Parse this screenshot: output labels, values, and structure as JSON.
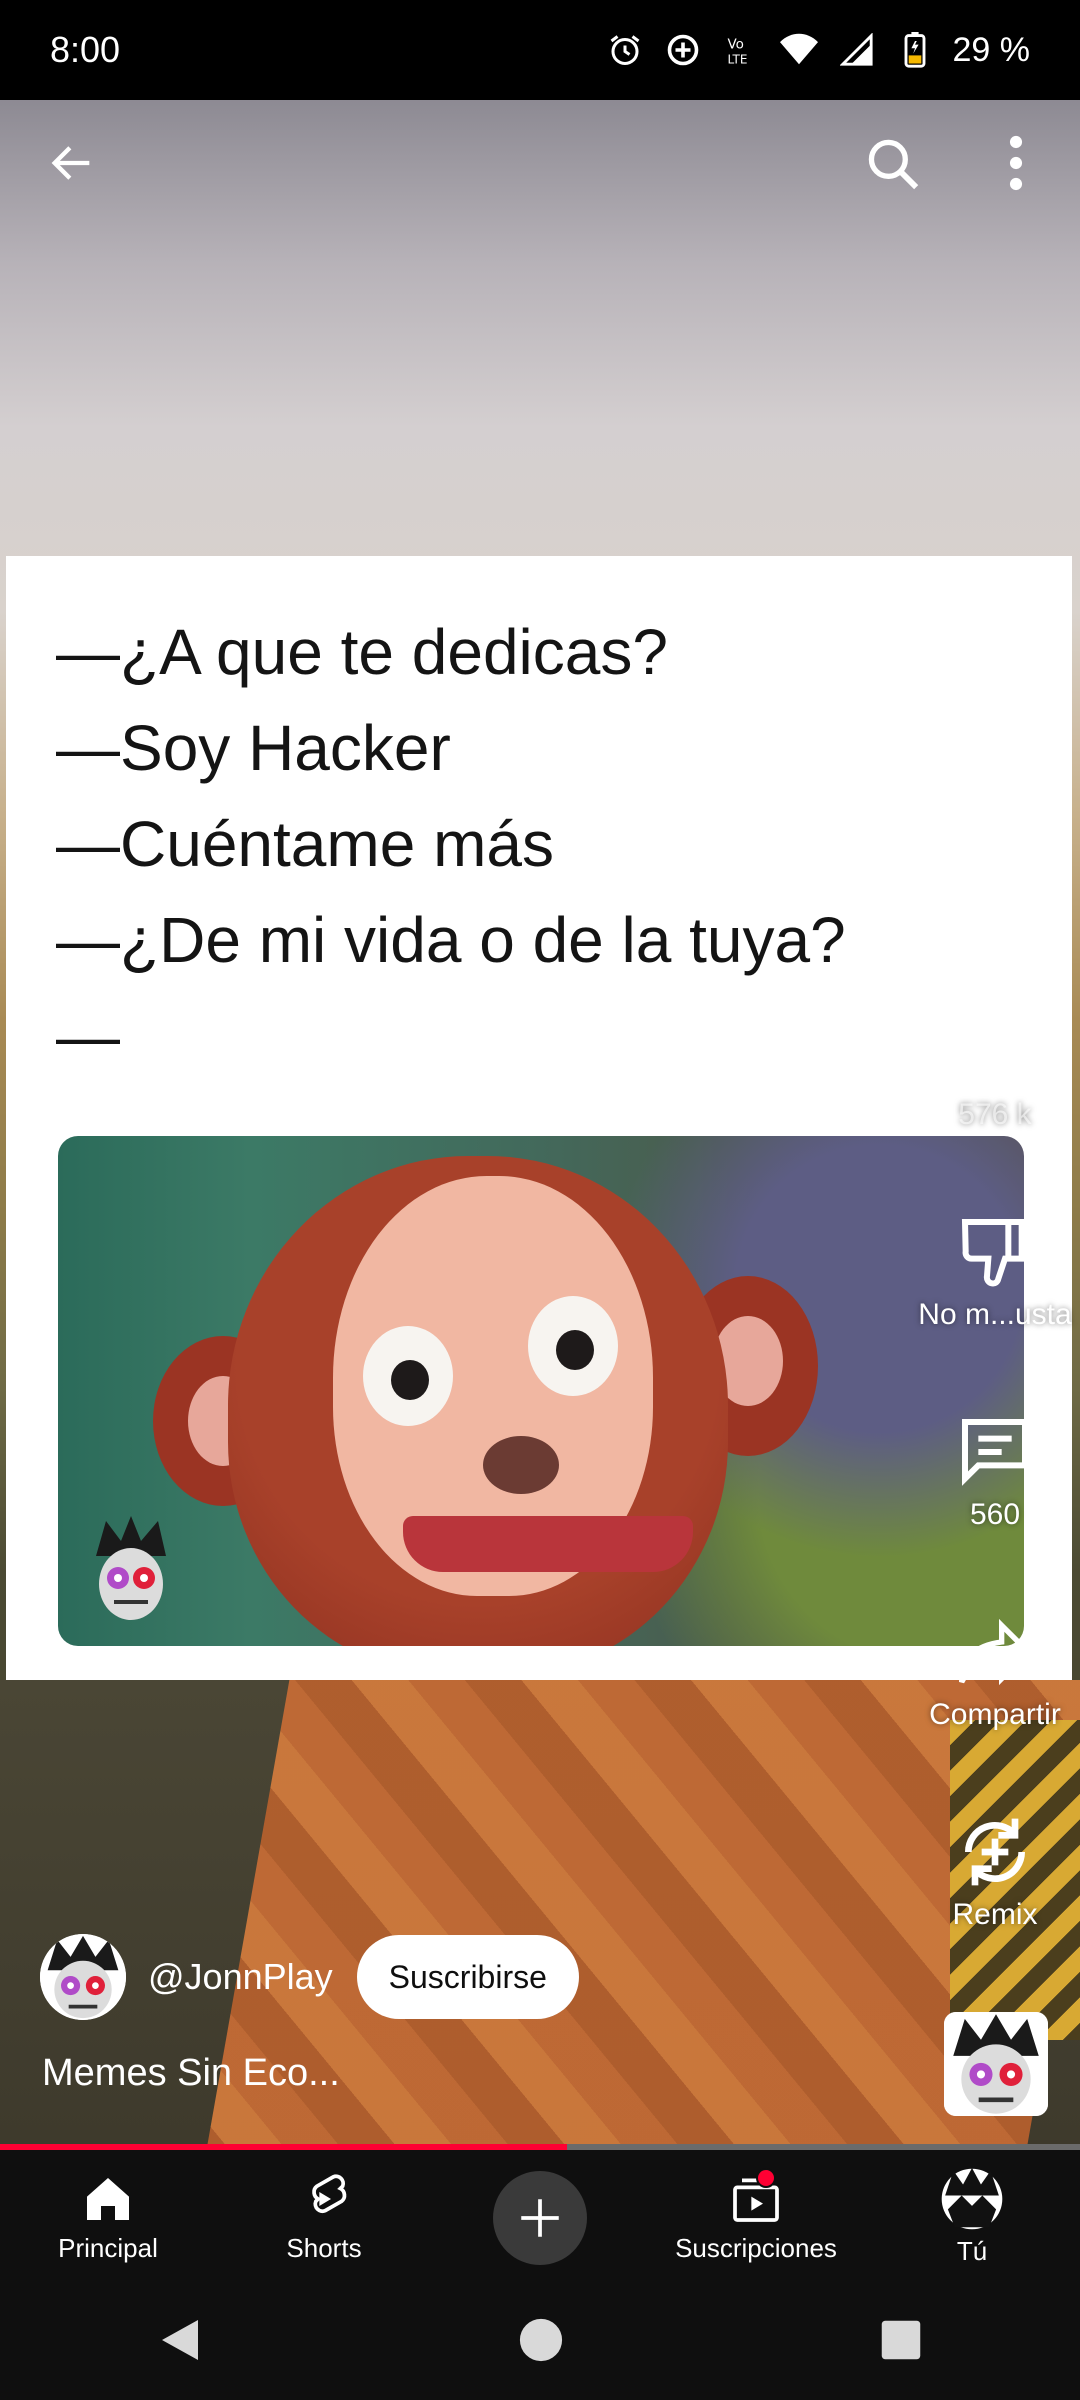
{
  "status_bar": {
    "time": "8:00",
    "battery": "29 %"
  },
  "meme": {
    "lines": [
      "—¿A que te dedicas?",
      "—Soy Hacker",
      "—Cuéntame más",
      "—¿De mi vida o de la tuya?",
      "—"
    ]
  },
  "actions": {
    "like_count": "576 k",
    "dislike_label": "No m...usta",
    "comment_count": "560",
    "share_label": "Compartir",
    "remix_label": "Remix"
  },
  "channel": {
    "handle": "@JonnPlay",
    "subscribe_label": "Suscribirse",
    "video_title": "Memes Sin Eco..."
  },
  "progress": {
    "fraction": 0.525
  },
  "bottom_nav": {
    "items": [
      {
        "label": "Principal",
        "icon": "home-icon"
      },
      {
        "label": "Shorts",
        "icon": "shorts-icon"
      },
      {
        "label": "",
        "icon": "plus-icon"
      },
      {
        "label": "Suscripciones",
        "icon": "subscriptions-icon"
      },
      {
        "label": "Tú",
        "icon": "profile-avatar"
      }
    ]
  },
  "colors": {
    "accent": "#ff0033",
    "nav_bg": "#0f0f0f"
  }
}
